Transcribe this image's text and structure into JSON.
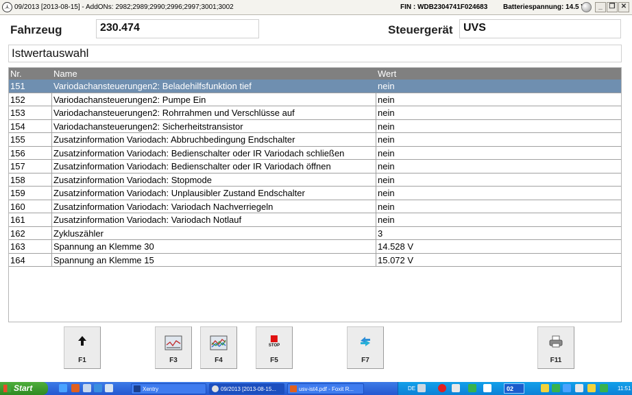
{
  "titlebar": {
    "title": "09/2013 [2013-08-15] - AddONs: 2982;2989;2990;2996;2997;3001;3002",
    "fin": "FIN : WDB2304741F024683",
    "battery": "Batteriespannung: 14.5 V"
  },
  "header": {
    "fahrzeug_label": "Fahrzeug",
    "fahrzeug_value": "230.474",
    "steuergeraet_label": "Steuergerät",
    "steuergeraet_value": "UVS",
    "section_title": "Istwertauswahl"
  },
  "table": {
    "columns": {
      "nr": "Nr.",
      "name": "Name",
      "wert": "Wert"
    },
    "rows": [
      {
        "nr": "151",
        "name": "Variodachansteuerungen2: Beladehilfsfunktion tief",
        "wert": "nein",
        "selected": true
      },
      {
        "nr": "152",
        "name": "Variodachansteuerungen2: Pumpe Ein",
        "wert": "nein"
      },
      {
        "nr": "153",
        "name": "Variodachansteuerungen2: Rohrrahmen und Verschlüsse auf",
        "wert": "nein"
      },
      {
        "nr": "154",
        "name": "Variodachansteuerungen2: Sicherheitstransistor",
        "wert": "nein"
      },
      {
        "nr": "155",
        "name": "Zusatzinformation Variodach: Abbruchbedingung Endschalter",
        "wert": "nein"
      },
      {
        "nr": "156",
        "name": "Zusatzinformation Variodach: Bedienschalter oder IR Variodach schließen",
        "wert": "nein"
      },
      {
        "nr": "157",
        "name": "Zusatzinformation Variodach: Bedienschalter oder IR Variodach öffnen",
        "wert": "nein"
      },
      {
        "nr": "158",
        "name": "Zusatzinformation Variodach: Stopmode",
        "wert": "nein"
      },
      {
        "nr": "159",
        "name": "Zusatzinformation Variodach: Unplausibler Zustand Endschalter",
        "wert": "nein"
      },
      {
        "nr": "160",
        "name": "Zusatzinformation Variodach: Variodach Nachverriegeln",
        "wert": "nein"
      },
      {
        "nr": "161",
        "name": "Zusatzinformation Variodach: Variodach Notlauf",
        "wert": "nein"
      },
      {
        "nr": "162",
        "name": "Zykluszähler",
        "wert": "3"
      },
      {
        "nr": "163",
        "name": "Spannung an Klemme 30",
        "wert": "14.528 V"
      },
      {
        "nr": "164",
        "name": "Spannung an Klemme 15",
        "wert": "15.072 V"
      }
    ]
  },
  "fkeys": [
    {
      "label": "F1",
      "icon": "up-arrow-icon"
    },
    {
      "label": "F3",
      "icon": "graph-icon"
    },
    {
      "label": "F4",
      "icon": "multi-graph-icon"
    },
    {
      "label": "F5",
      "icon": "stop-icon",
      "icon_text": "STOP"
    },
    {
      "label": "F7",
      "icon": "swap-arrows-icon"
    },
    {
      "label": "F11",
      "icon": "printer-icon"
    }
  ],
  "taskbar": {
    "start": "Start",
    "tasks": [
      "Xentry",
      "09/2013 [2013-08-15...",
      "usv-ist4.pdf - Foxit R..."
    ],
    "lang": "DE",
    "badge": "02",
    "time": "11:51"
  },
  "colors": {
    "selected_row": "#6f8fb0",
    "header_bg": "#808080",
    "taskbar": "#2458d0",
    "start": "#2e8a22"
  }
}
